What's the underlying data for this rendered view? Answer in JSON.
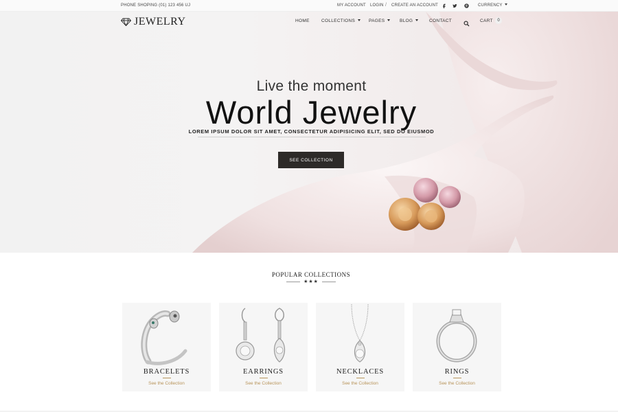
{
  "topbar": {
    "phone": "PHONE SHOPING (01) 123 456 UJ",
    "my_account": "MY ACCOUNT",
    "login": "LOGIN",
    "separator": "/",
    "create_account": "CREATE AN ACCOUNT",
    "social": [
      "facebook-icon",
      "twitter-icon",
      "pinterest-icon"
    ],
    "currency": "CURRENCY"
  },
  "header": {
    "logo": "JEWELRY",
    "nav": [
      "HOME",
      "COLLECTIONS",
      "PAGES",
      "BLOG",
      "CONTACT"
    ],
    "cart_label": "CART",
    "cart_count": "0"
  },
  "hero": {
    "tagline": "Live the moment",
    "headline": "World Jewelry",
    "subline": "LOREM IPSUM DOLOR SIT AMET, CONSECTETUR ADIPISICING ELIT, SED DO EIUSMOD",
    "cta": "SEE COLLECTION"
  },
  "collections": {
    "title": "POPULAR COLLECTIONS",
    "stars": "★★★",
    "items": [
      {
        "title": "BRACELETS",
        "link": "See the Collection"
      },
      {
        "title": "EARRINGS",
        "link": "See the Collection"
      },
      {
        "title": "NECKLACES",
        "link": "See the Collection"
      },
      {
        "title": "RINGS",
        "link": "See the Collection"
      }
    ]
  },
  "colors": {
    "accent_gold": "#b8945a",
    "cta_bg": "#2d2a28",
    "card_bg": "#f6f6f6"
  }
}
